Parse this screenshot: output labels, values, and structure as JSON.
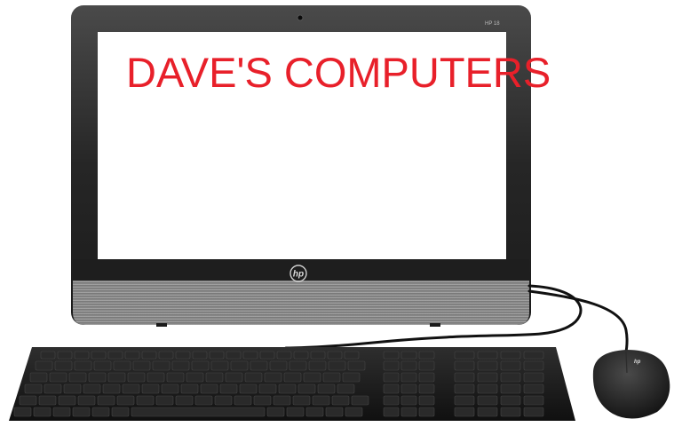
{
  "headline": "DAVE'S COMPUTERS",
  "brand": {
    "logo_text": "hp",
    "model_text": "HP 18",
    "mouse_logo_text": "hp"
  },
  "colors": {
    "headline": "#e8202a",
    "bezel": "#2b2b2b",
    "screen": "#ffffff",
    "speaker_grille": "#8c8c8c",
    "keyboard": "#1a1a1a",
    "keycap": "#2a2a2a",
    "cable": "#111111"
  },
  "icons": [
    "monitor-icon",
    "keyboard-icon",
    "mouse-icon",
    "webcam-icon",
    "hp-logo-icon"
  ]
}
